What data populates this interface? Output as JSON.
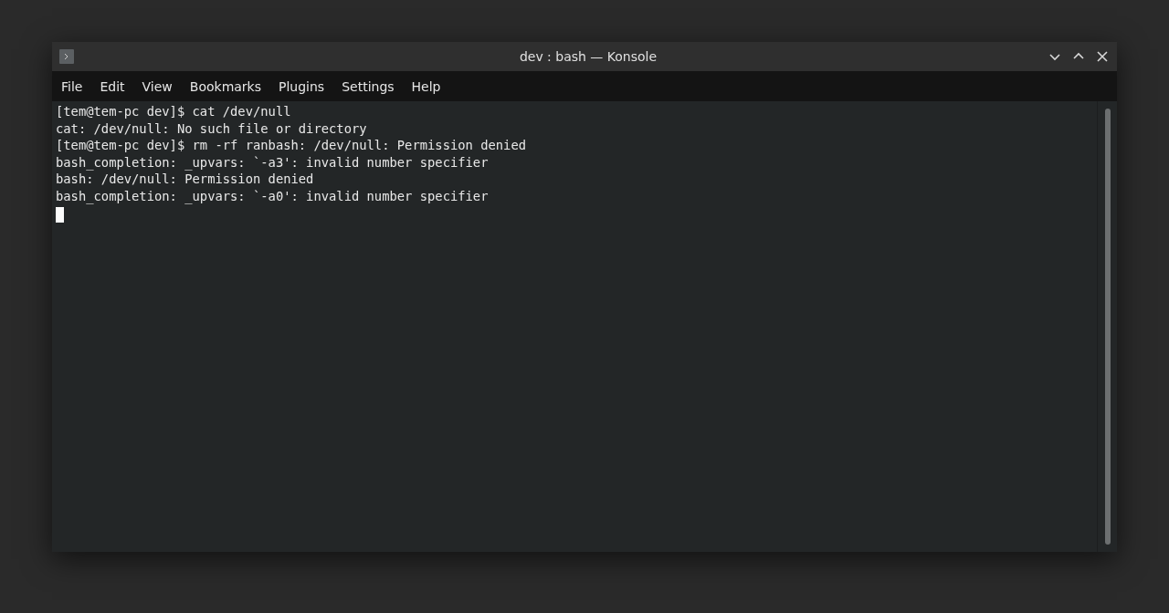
{
  "window": {
    "title": "dev : bash — Konsole"
  },
  "menu": [
    "File",
    "Edit",
    "View",
    "Bookmarks",
    "Plugins",
    "Settings",
    "Help"
  ],
  "terminal": {
    "lines": [
      "[tem@tem-pc dev]$ cat /dev/null",
      "cat: /dev/null: No such file or directory",
      "[tem@tem-pc dev]$ rm -rf ranbash: /dev/null: Permission denied",
      "bash_completion: _upvars: `-a3': invalid number specifier",
      "bash: /dev/null: Permission denied",
      "bash_completion: _upvars: `-a0': invalid number specifier"
    ]
  }
}
